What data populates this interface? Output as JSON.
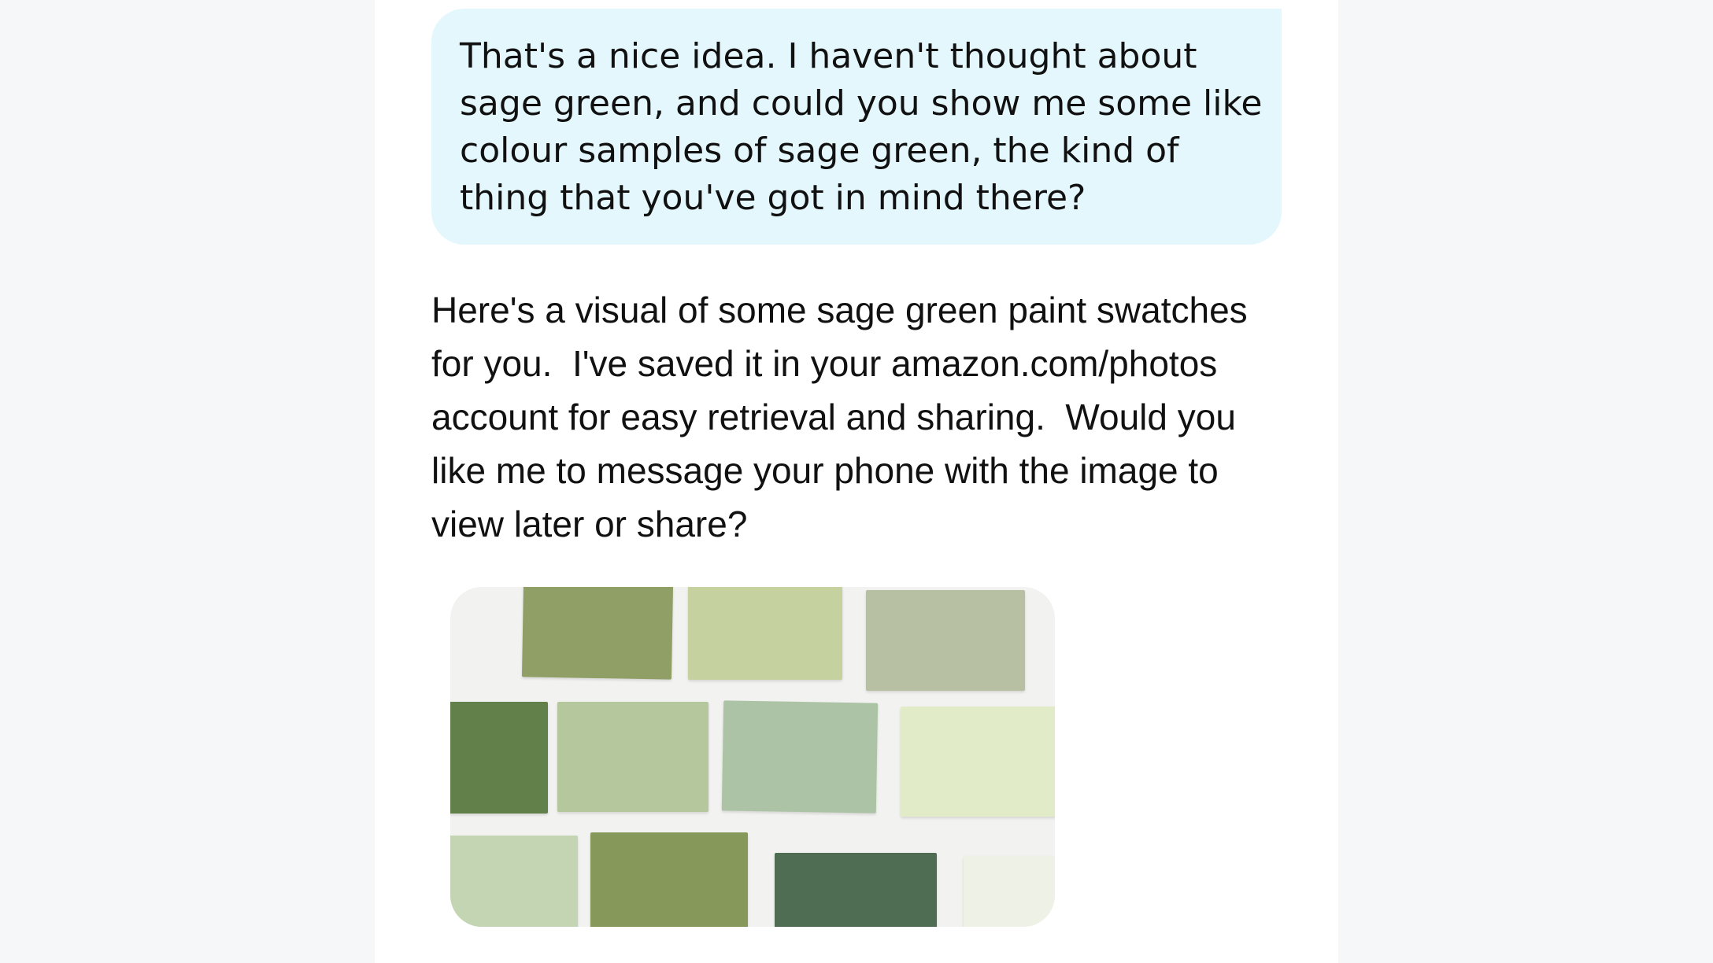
{
  "conversation": {
    "user_message": {
      "lines": [
        "That's a nice idea. I haven't thought about",
        "sage green, and could you show me some like",
        "colour samples of sage green, the kind of",
        "thing that you've got in mind there?"
      ]
    },
    "assistant_message": {
      "lines": [
        "Here's a visual of some sage green paint swatches",
        "for you.  I've saved it in your amazon.com/photos",
        "account for easy retrieval and sharing.  Would you",
        "like me to message your phone with the image to",
        "view later or share?"
      ]
    },
    "image": {
      "content": "sage green paint swatches",
      "swatch_colors": [
        "#8f9f66",
        "#c5d19f",
        "#b8c0a3",
        "#61804a",
        "#b5c79c",
        "#adc3a6",
        "#e2ebc8",
        "#c3d5b3",
        "#86985a",
        "#4f6d52",
        "#eef2e6"
      ]
    }
  }
}
